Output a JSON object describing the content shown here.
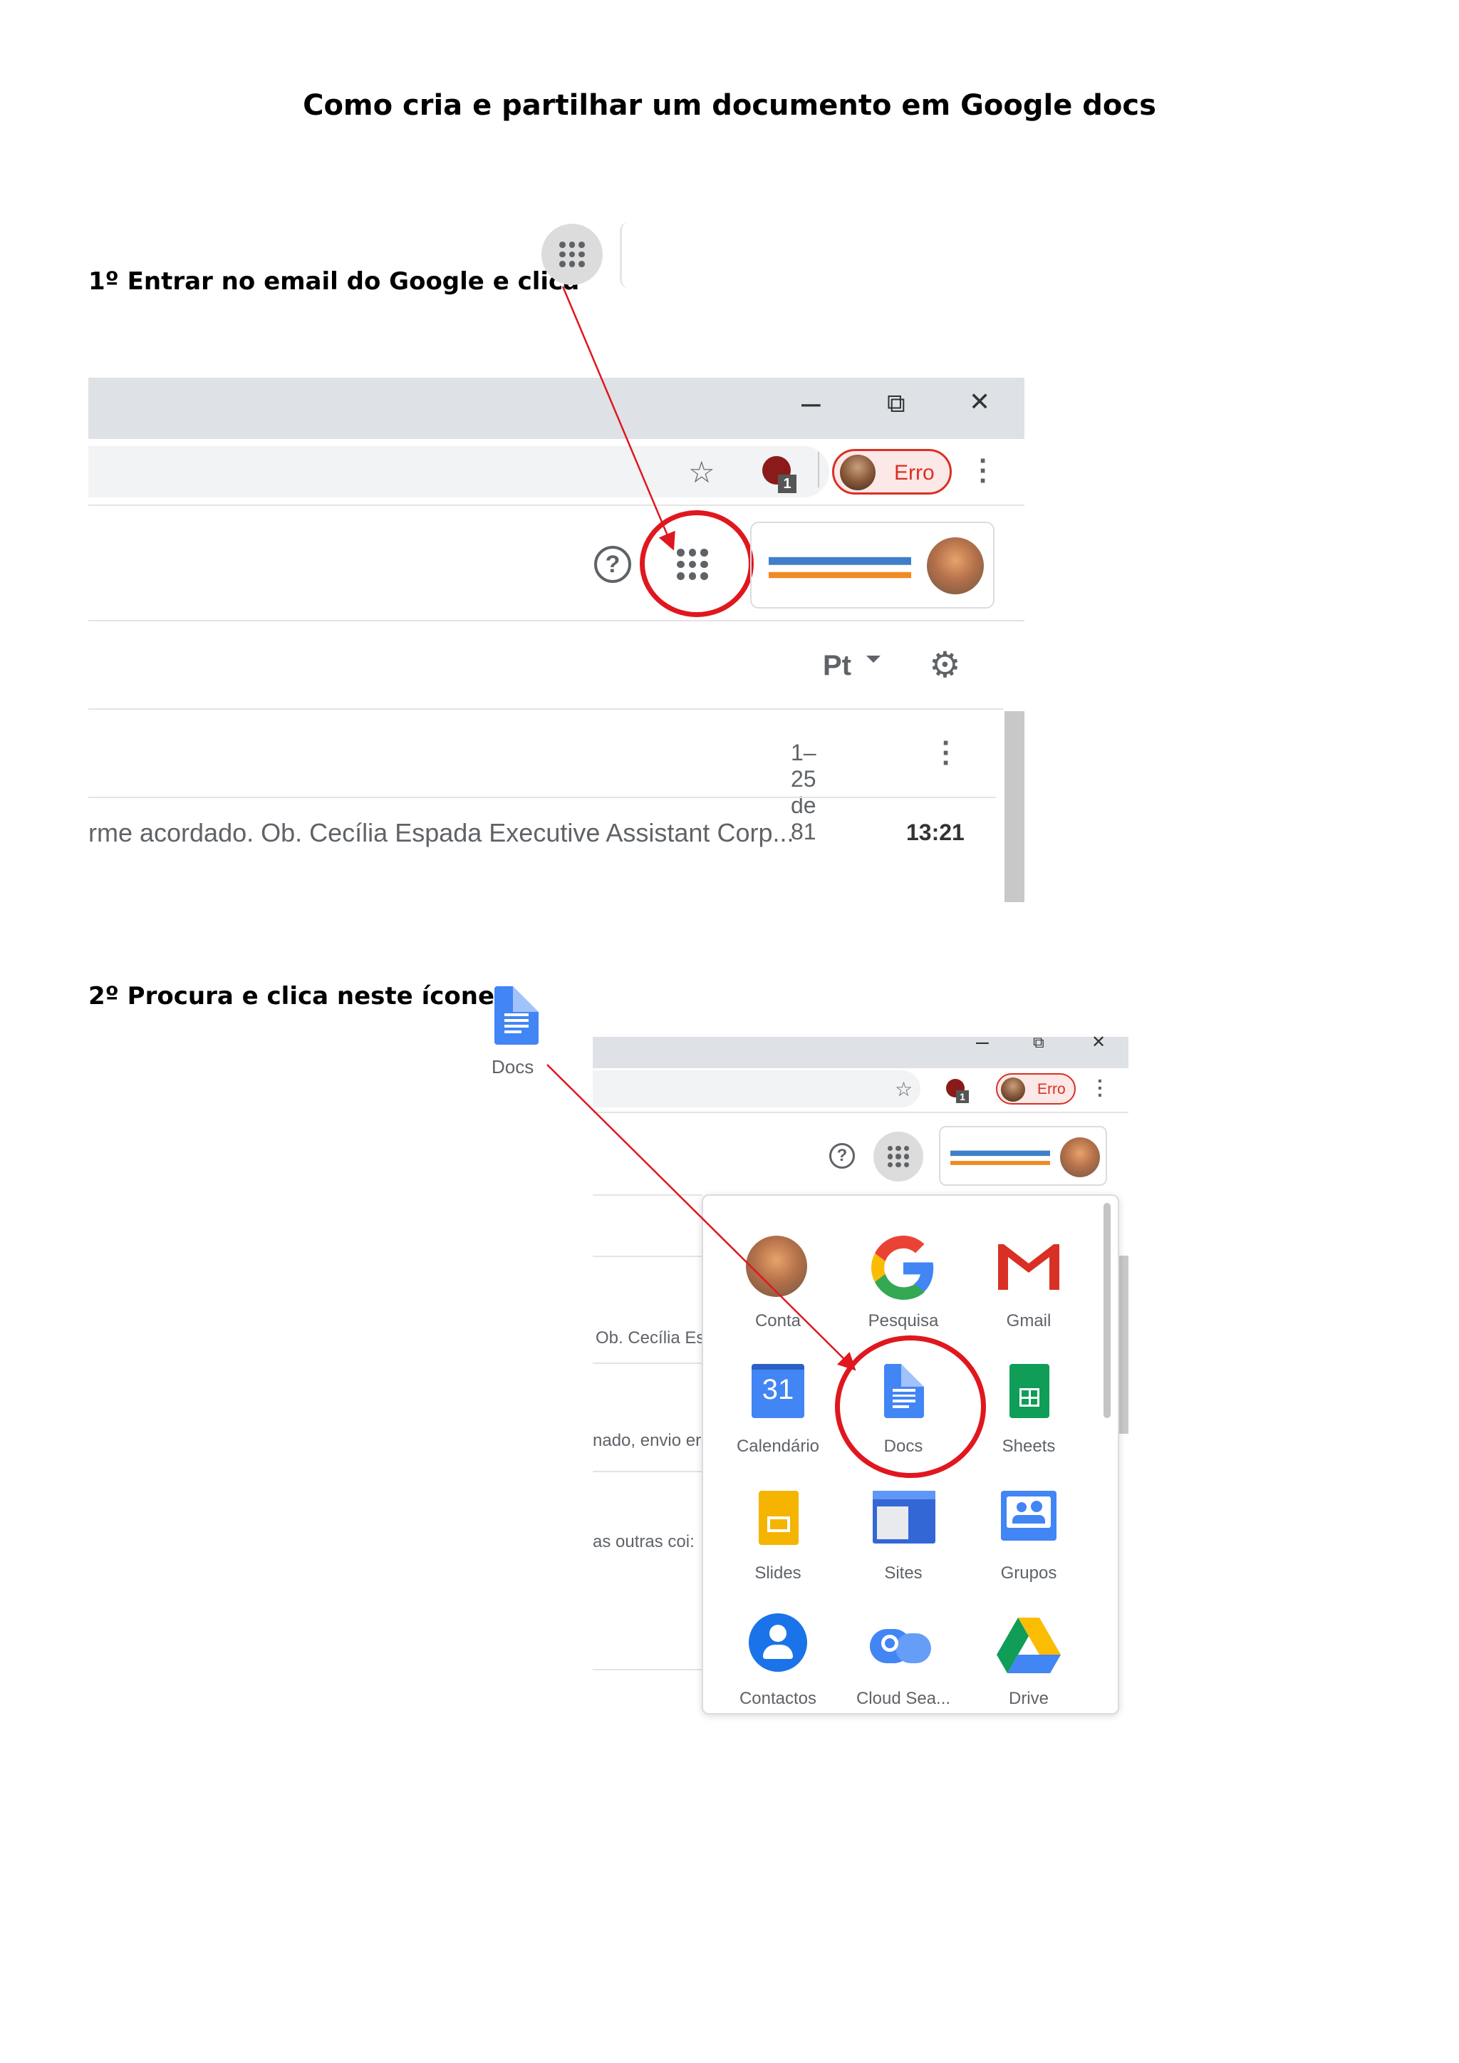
{
  "title": "Como cria e partilhar um documento em Google docs",
  "step1": {
    "text": "1º Entrar no email do Google e clica",
    "window": {
      "minimize": "–",
      "restore": "⧉",
      "close": "✕",
      "profile_label": "Erro",
      "extension_badge": "1",
      "language_label": "Pt",
      "pagination": "1–25 de 81",
      "email_snippet": "rme acordado. Ob. Cecília Espada Executive Assistant Corp...",
      "email_time": "13:21",
      "help": "?"
    }
  },
  "step2": {
    "text": "2º Procura e clica neste ícone",
    "docs_caption": "Docs",
    "window": {
      "minimize": "–",
      "restore": "⧉",
      "close": "✕",
      "profile_label": "Erro",
      "extension_badge": "1",
      "help": "?",
      "snippets": [
        "Ob. Cecília Es",
        "nado, envio er",
        "as outras coi:"
      ]
    },
    "apps": [
      {
        "label": "Conta",
        "icon": "account-avatar-icon"
      },
      {
        "label": "Pesquisa",
        "icon": "google-g-icon"
      },
      {
        "label": "Gmail",
        "icon": "gmail-icon"
      },
      {
        "label": "Calendário",
        "icon": "calendar-icon",
        "day": "31"
      },
      {
        "label": "Docs",
        "icon": "docs-icon"
      },
      {
        "label": "Sheets",
        "icon": "sheets-icon"
      },
      {
        "label": "Slides",
        "icon": "slides-icon"
      },
      {
        "label": "Sites",
        "icon": "sites-icon"
      },
      {
        "label": "Grupos",
        "icon": "groups-icon"
      },
      {
        "label": "Contactos",
        "icon": "contacts-icon"
      },
      {
        "label": "Cloud Sea...",
        "icon": "cloud-search-icon"
      },
      {
        "label": "Drive",
        "icon": "drive-icon"
      }
    ]
  },
  "colors": {
    "annotation_red": "#e0171e",
    "docs_blue": "#4285f4",
    "titlebar_gray": "#dee1e6"
  }
}
